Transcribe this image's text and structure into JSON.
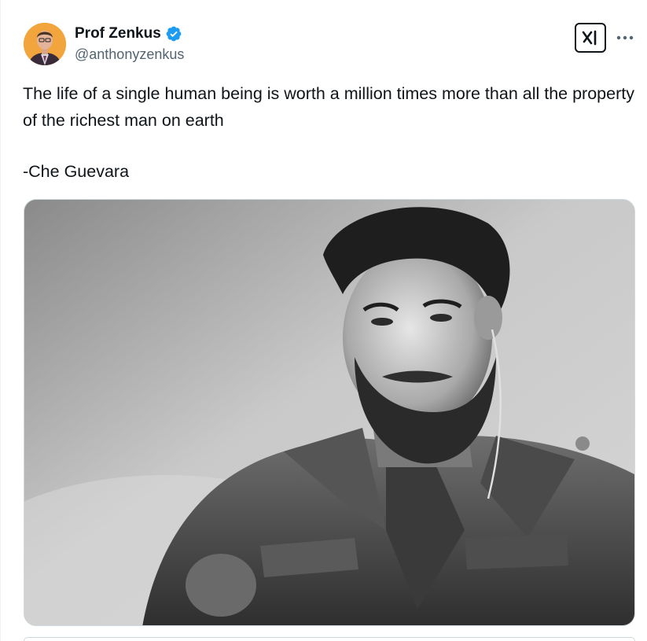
{
  "author": {
    "display_name": "Prof Zenkus",
    "handle": "@anthonyzenkus",
    "verified": true
  },
  "icons": {
    "verified": "verified-badge-icon",
    "grok": "grok-icon",
    "more": "more-options-icon"
  },
  "colors": {
    "verified_blue": "#1d9bf0",
    "text": "#0f1419",
    "secondary_text": "#536471"
  },
  "tweet": {
    "text_line_1": "The life of a single human being is worth a million times more than all the property of the richest man on earth",
    "text_line_2": "-Che Guevara"
  },
  "media": {
    "kind": "black-and-white portrait photograph"
  }
}
